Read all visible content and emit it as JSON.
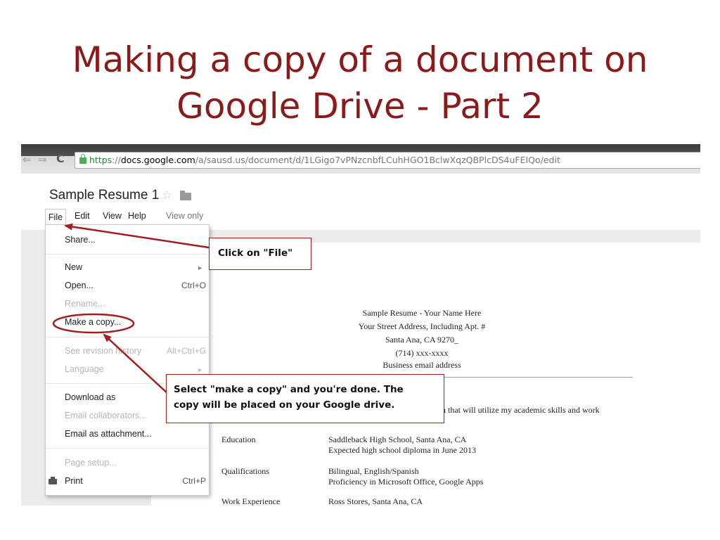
{
  "slide": {
    "title_line1": "Making a copy of a document on",
    "title_line2": "Google Drive - Part 2"
  },
  "browser": {
    "url_https": "https",
    "url_sep": "://",
    "url_host": "docs.google.com",
    "url_path": "/a/sausd.us/document/d/1LGigo7vPNzcnbfLCuhHGO1BclwXqzQBPlcDS4uFEIQo/edit"
  },
  "doc": {
    "title": "Sample Resume 1",
    "menu": {
      "file": "File",
      "edit": "Edit",
      "view": "View",
      "help": "Help",
      "view_only": "View only"
    }
  },
  "file_menu": {
    "share": "Share...",
    "new": "New",
    "open": "Open...",
    "open_shortcut": "Ctrl+O",
    "rename": "Rename...",
    "make_copy": "Make a copy...",
    "revision_history": "See revision history",
    "revision_shortcut": "Alt+Ctrl+G",
    "language": "Language",
    "download_as": "Download as",
    "email_collaborators": "Email collaborators...",
    "email_attachment": "Email as attachment...",
    "page_setup": "Page setup...",
    "print": "Print",
    "print_shortcut": "Ctrl+P"
  },
  "resume": {
    "name_line": "Sample Resume - Your Name Here",
    "address": "Your Street Address, Including Apt. #",
    "city": "Santa Ana, CA 9270_",
    "phone": "(714) xxx-xxxx",
    "email": "Business email address",
    "objective_tail": "n that will utilize my academic skills and work",
    "education_label": "Education",
    "education_1": "Saddleback High School, Santa Ana, CA",
    "education_2": "Expected high school diploma in June 2013",
    "qualifications_label": "Qualifications",
    "qualifications_1": "Bilingual, English/Spanish",
    "qualifications_2": "Proficiency in Microsoft Office, Google Apps",
    "work_label": "Work Experience",
    "work_1": "Ross Stores, Santa Ana, CA"
  },
  "callouts": {
    "file": "Click on \"File\"",
    "copy_line1": "Select \"make a copy\" and you're done. The",
    "copy_line2": "copy will be placed on your Google drive."
  },
  "colors": {
    "title": "#8b1a1a",
    "annotation": "#a51c1c"
  }
}
